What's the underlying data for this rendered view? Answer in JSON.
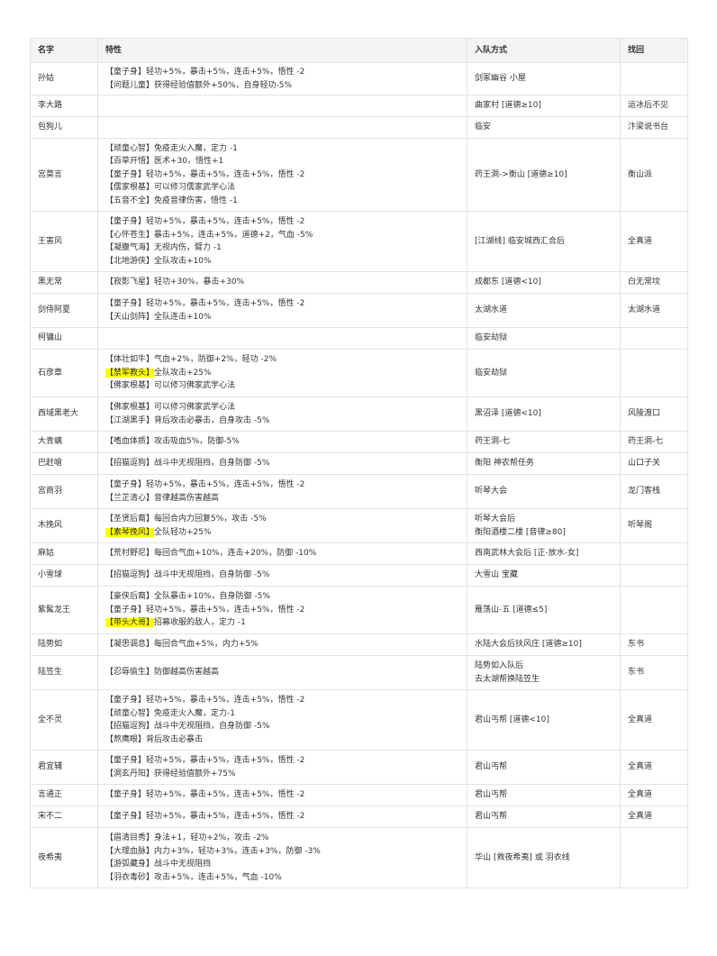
{
  "headers": [
    "名字",
    "特性",
    "入队方式",
    "找回"
  ],
  "rows": [
    {
      "name": "孙姑",
      "traits": [
        {
          "tag": "【童子身】",
          "text": "轻功+5%，暴击+5%，连击+5%，悟性 -2"
        },
        {
          "tag": "【问题儿童】",
          "text": "获得经验值额外+50%，自身轻功-5%"
        }
      ],
      "join": [
        "剑冢幽谷 小屋"
      ],
      "recover": "",
      "h": 29
    },
    {
      "name": "李大路",
      "traits": [],
      "join": [
        "曲家村 [道德≥10]"
      ],
      "recover": "运冰后不见",
      "h": 24
    },
    {
      "name": "包狗儿",
      "traits": [],
      "join": [
        "临安"
      ],
      "recover": "汴梁说书台",
      "h": 24
    },
    {
      "name": "宫莫言",
      "traits": [
        {
          "tag": "【顽童心智】",
          "text": "免疫走火入魔，定力 -1"
        },
        {
          "tag": "【百草开悟】",
          "text": "医术+30，悟性+1"
        },
        {
          "tag": "【童子身】",
          "text": "轻功+5%，暴击+5%，连击+5%，悟性 -2"
        },
        {
          "tag": "【儒家根基】",
          "text": "可以修习儒家武学心法"
        },
        {
          "tag": "【五音不全】",
          "text": "免疫音律伤害，悟性 -1"
        }
      ],
      "join": [
        "药王洞->衡山 [道德≥10]"
      ],
      "recover": "衡山派",
      "h": 81
    },
    {
      "name": "王害风",
      "traits": [
        {
          "tag": "【童子身】",
          "text": "轻功+5%，暴击+5%，连击+5%，悟性 -2"
        },
        {
          "tag": "【心怀苍生】",
          "text": "暴击+5%，连击+5%，道德+2，气血 -5%"
        },
        {
          "tag": "【凝腹气海】",
          "text": "无视内伤，臂力 -1"
        },
        {
          "tag": "【北地游侠】",
          "text": "全队攻击+10%"
        }
      ],
      "join": [
        "[江湖线] 临安城西汇合后"
      ],
      "recover": "全真道",
      "h": 67
    },
    {
      "name": "黑无常",
      "traits": [
        {
          "tag": "【寂影飞星】",
          "text": "轻功+30%，暴击+30%"
        }
      ],
      "join": [
        "成都东 [道德<10]"
      ],
      "recover": "白无常坟",
      "h": 24
    },
    {
      "name": "剑侍阿夏",
      "traits": [
        {
          "tag": "【童子身】",
          "text": "轻功+5%，暴击+5%，连击+5%，悟性 -2"
        },
        {
          "tag": "【天山剑阵】",
          "text": "全队连击+10%"
        }
      ],
      "join": [
        "太湖水道"
      ],
      "recover": "太湖水道",
      "h": 38
    },
    {
      "name": "柯镛山",
      "traits": [],
      "join": [
        "临安劫狱"
      ],
      "recover": "",
      "h": 24
    },
    {
      "name": "石彦章",
      "traits": [
        {
          "tag": "【体壮如牛】",
          "text": "气血+2%，防御+2%，轻功 -2%"
        },
        {
          "tag": "【禁军教头】",
          "text": "全队攻击+25%",
          "hl": true
        },
        {
          "tag": "【佛家根基】",
          "text": "可以修习佛家武学心法"
        }
      ],
      "join": [
        "临安劫狱"
      ],
      "recover": "",
      "h": 53
    },
    {
      "name": "西域黑老大",
      "traits": [
        {
          "tag": "【佛家根基】",
          "text": "可以修习佛家武学心法"
        },
        {
          "tag": "【江湖黑手】",
          "text": "背后攻击必暴击，自身攻击 -5%"
        }
      ],
      "join": [
        "黑沼泽 [道德<10]"
      ],
      "recover": "风陵渡口",
      "h": 38
    },
    {
      "name": "大青螭",
      "traits": [
        {
          "tag": "【嗜血体质】",
          "text": "攻击吸血5%，防御-5%"
        }
      ],
      "join": [
        "药王洞-七"
      ],
      "recover": "药王洞-七",
      "h": 24
    },
    {
      "name": "巴赶嗆",
      "traits": [
        {
          "tag": "【招猫逗狗】",
          "text": "战斗中无视阻挡，自身防御 -5%"
        }
      ],
      "join": [
        "衡阳 神农帮任务"
      ],
      "recover": "山口子关",
      "h": 24
    },
    {
      "name": "宫商羽",
      "traits": [
        {
          "tag": "【童子身】",
          "text": "轻功+5%，暴击+5%，连击+5%，悟性 -2"
        },
        {
          "tag": "【兰芷清心】",
          "text": "音律越高伤害越高"
        }
      ],
      "join": [
        "听琴大会"
      ],
      "recover": "龙门客栈",
      "h": 38
    },
    {
      "name": "木挽风",
      "traits": [
        {
          "tag": "【圣贤后裔】",
          "text": "每回合内力回复5%，攻击 -5%"
        },
        {
          "tag": "【素琴挽风】",
          "text": "全队轻功+25%",
          "hl": true
        }
      ],
      "join": [
        "听琴大会后",
        "衡阳酒楼二楼 [音律≥80]"
      ],
      "recover": "听琴阁",
      "h": 38
    },
    {
      "name": "麻姑",
      "traits": [
        {
          "tag": "【荒村野尼】",
          "text": "每回合气血+10%，连击+20%，防御 -10%"
        }
      ],
      "join": [
        "西南武林大会后 [正-放水-女]"
      ],
      "recover": "",
      "h": 24
    },
    {
      "name": "小雪球",
      "traits": [
        {
          "tag": "【招猫逗狗】",
          "text": "战斗中无视阻挡，自身防御 -5%"
        }
      ],
      "join": [
        "大雪山 宝藏"
      ],
      "recover": "",
      "h": 24
    },
    {
      "name": "紫髯龙王",
      "traits": [
        {
          "tag": "【豪侠后裔】",
          "text": "全队暴击+10%，自身防御 -5%"
        },
        {
          "tag": "【童子身】",
          "text": "轻功+5%，暴击+5%，连击+5%，悟性 -2"
        },
        {
          "tag": "【带头大哥】",
          "text": "招募收服的敌人，定力 -1",
          "hl": true
        }
      ],
      "join": [
        "雁荡山-五 [道德≤5]"
      ],
      "recover": "",
      "h": 53
    },
    {
      "name": "陆势如",
      "traits": [
        {
          "tag": "【凝思调息】",
          "text": "每回合气血+5%，内力+5%"
        }
      ],
      "join": [
        "水陆大会后扶风庄 [道德≥10]"
      ],
      "recover": "东书",
      "h": 24
    },
    {
      "name": "陆笠生",
      "traits": [
        {
          "tag": "【忍辱偷生】",
          "text": "防御越高伤害越高"
        }
      ],
      "join": [
        "陆势如入队后",
        "去太湖帮换陆笠生"
      ],
      "recover": "东书",
      "h": 38
    },
    {
      "name": "全不灵",
      "traits": [
        {
          "tag": "【童子身】",
          "text": "轻功+5%，暴击+5%，连击+5%，悟性 -2"
        },
        {
          "tag": "【顽童心智】",
          "text": "免疫走火入魔，定力-1"
        },
        {
          "tag": "【招猫逗狗】",
          "text": "战斗中无视阻挡，自身防御 -5%"
        },
        {
          "tag": "【熬鹰眼】",
          "text": "背后攻击必暴击"
        }
      ],
      "join": [
        "君山丐帮 [道德<10]"
      ],
      "recover": "全真道",
      "h": 67
    },
    {
      "name": "君宜辅",
      "traits": [
        {
          "tag": "【童子身】",
          "text": "轻功+5%，暴击+5%，连击+5%，悟性 -2"
        },
        {
          "tag": "【洞玄丹阳】",
          "text": "获得经验值额外+75%"
        }
      ],
      "join": [
        "君山丐帮"
      ],
      "recover": "全真道",
      "h": 38
    },
    {
      "name": "言通正",
      "traits": [
        {
          "tag": "【童子身】",
          "text": "轻功+5%，暴击+5%，连击+5%，悟性 -2"
        }
      ],
      "join": [
        "君山丐帮"
      ],
      "recover": "全真道",
      "h": 24
    },
    {
      "name": "宋不二",
      "traits": [
        {
          "tag": "【童子身】",
          "text": "轻功+5%，暴击+5%，连击+5%，悟性 -2"
        }
      ],
      "join": [
        "君山丐帮"
      ],
      "recover": "全真道",
      "h": 24
    },
    {
      "name": "夜希夷",
      "traits": [
        {
          "tag": "【眉清目秀】",
          "text": "身法+1，轻功+2%，攻击 -2%"
        },
        {
          "tag": "【大理血脉】",
          "text": "内力+3%，轻功+3%，连击+3%，防御 -3%"
        },
        {
          "tag": "【游弧藏身】",
          "text": "战斗中无视阻挡"
        },
        {
          "tag": "【羽衣毒砂】",
          "text": "攻击+5%，连击+5%，气血 -10%"
        }
      ],
      "join": [
        "华山 [救夜希夷] 或 羽衣线"
      ],
      "recover": "",
      "h": 67
    }
  ]
}
